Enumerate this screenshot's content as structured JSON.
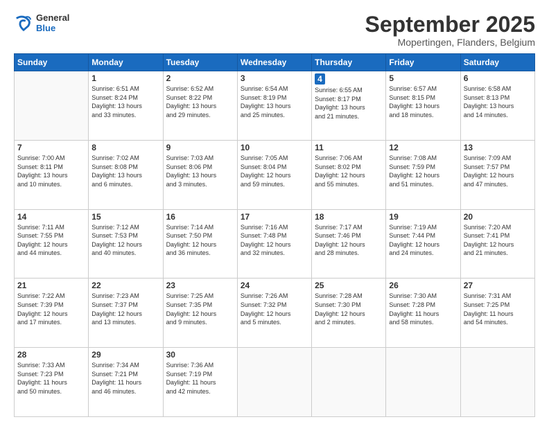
{
  "header": {
    "logo_line1": "General",
    "logo_line2": "Blue",
    "month": "September 2025",
    "location": "Mopertingen, Flanders, Belgium"
  },
  "weekdays": [
    "Sunday",
    "Monday",
    "Tuesday",
    "Wednesday",
    "Thursday",
    "Friday",
    "Saturday"
  ],
  "weeks": [
    [
      {
        "day": "",
        "info": ""
      },
      {
        "day": "1",
        "info": "Sunrise: 6:51 AM\nSunset: 8:24 PM\nDaylight: 13 hours\nand 33 minutes."
      },
      {
        "day": "2",
        "info": "Sunrise: 6:52 AM\nSunset: 8:22 PM\nDaylight: 13 hours\nand 29 minutes."
      },
      {
        "day": "3",
        "info": "Sunrise: 6:54 AM\nSunset: 8:19 PM\nDaylight: 13 hours\nand 25 minutes."
      },
      {
        "day": "4",
        "info": "Sunrise: 6:55 AM\nSunset: 8:17 PM\nDaylight: 13 hours\nand 21 minutes.",
        "thursday": true
      },
      {
        "day": "5",
        "info": "Sunrise: 6:57 AM\nSunset: 8:15 PM\nDaylight: 13 hours\nand 18 minutes."
      },
      {
        "day": "6",
        "info": "Sunrise: 6:58 AM\nSunset: 8:13 PM\nDaylight: 13 hours\nand 14 minutes."
      }
    ],
    [
      {
        "day": "7",
        "info": "Sunrise: 7:00 AM\nSunset: 8:11 PM\nDaylight: 13 hours\nand 10 minutes."
      },
      {
        "day": "8",
        "info": "Sunrise: 7:02 AM\nSunset: 8:08 PM\nDaylight: 13 hours\nand 6 minutes."
      },
      {
        "day": "9",
        "info": "Sunrise: 7:03 AM\nSunset: 8:06 PM\nDaylight: 13 hours\nand 3 minutes."
      },
      {
        "day": "10",
        "info": "Sunrise: 7:05 AM\nSunset: 8:04 PM\nDaylight: 12 hours\nand 59 minutes."
      },
      {
        "day": "11",
        "info": "Sunrise: 7:06 AM\nSunset: 8:02 PM\nDaylight: 12 hours\nand 55 minutes.",
        "thursday": false
      },
      {
        "day": "12",
        "info": "Sunrise: 7:08 AM\nSunset: 7:59 PM\nDaylight: 12 hours\nand 51 minutes."
      },
      {
        "day": "13",
        "info": "Sunrise: 7:09 AM\nSunset: 7:57 PM\nDaylight: 12 hours\nand 47 minutes."
      }
    ],
    [
      {
        "day": "14",
        "info": "Sunrise: 7:11 AM\nSunset: 7:55 PM\nDaylight: 12 hours\nand 44 minutes."
      },
      {
        "day": "15",
        "info": "Sunrise: 7:12 AM\nSunset: 7:53 PM\nDaylight: 12 hours\nand 40 minutes."
      },
      {
        "day": "16",
        "info": "Sunrise: 7:14 AM\nSunset: 7:50 PM\nDaylight: 12 hours\nand 36 minutes."
      },
      {
        "day": "17",
        "info": "Sunrise: 7:16 AM\nSunset: 7:48 PM\nDaylight: 12 hours\nand 32 minutes."
      },
      {
        "day": "18",
        "info": "Sunrise: 7:17 AM\nSunset: 7:46 PM\nDaylight: 12 hours\nand 28 minutes.",
        "thursday": false
      },
      {
        "day": "19",
        "info": "Sunrise: 7:19 AM\nSunset: 7:44 PM\nDaylight: 12 hours\nand 24 minutes."
      },
      {
        "day": "20",
        "info": "Sunrise: 7:20 AM\nSunset: 7:41 PM\nDaylight: 12 hours\nand 21 minutes."
      }
    ],
    [
      {
        "day": "21",
        "info": "Sunrise: 7:22 AM\nSunset: 7:39 PM\nDaylight: 12 hours\nand 17 minutes."
      },
      {
        "day": "22",
        "info": "Sunrise: 7:23 AM\nSunset: 7:37 PM\nDaylight: 12 hours\nand 13 minutes."
      },
      {
        "day": "23",
        "info": "Sunrise: 7:25 AM\nSunset: 7:35 PM\nDaylight: 12 hours\nand 9 minutes."
      },
      {
        "day": "24",
        "info": "Sunrise: 7:26 AM\nSunset: 7:32 PM\nDaylight: 12 hours\nand 5 minutes."
      },
      {
        "day": "25",
        "info": "Sunrise: 7:28 AM\nSunset: 7:30 PM\nDaylight: 12 hours\nand 2 minutes.",
        "thursday": false
      },
      {
        "day": "26",
        "info": "Sunrise: 7:30 AM\nSunset: 7:28 PM\nDaylight: 11 hours\nand 58 minutes."
      },
      {
        "day": "27",
        "info": "Sunrise: 7:31 AM\nSunset: 7:25 PM\nDaylight: 11 hours\nand 54 minutes."
      }
    ],
    [
      {
        "day": "28",
        "info": "Sunrise: 7:33 AM\nSunset: 7:23 PM\nDaylight: 11 hours\nand 50 minutes."
      },
      {
        "day": "29",
        "info": "Sunrise: 7:34 AM\nSunset: 7:21 PM\nDaylight: 11 hours\nand 46 minutes."
      },
      {
        "day": "30",
        "info": "Sunrise: 7:36 AM\nSunset: 7:19 PM\nDaylight: 11 hours\nand 42 minutes."
      },
      {
        "day": "",
        "info": ""
      },
      {
        "day": "",
        "info": "",
        "thursday": false
      },
      {
        "day": "",
        "info": ""
      },
      {
        "day": "",
        "info": ""
      }
    ]
  ]
}
